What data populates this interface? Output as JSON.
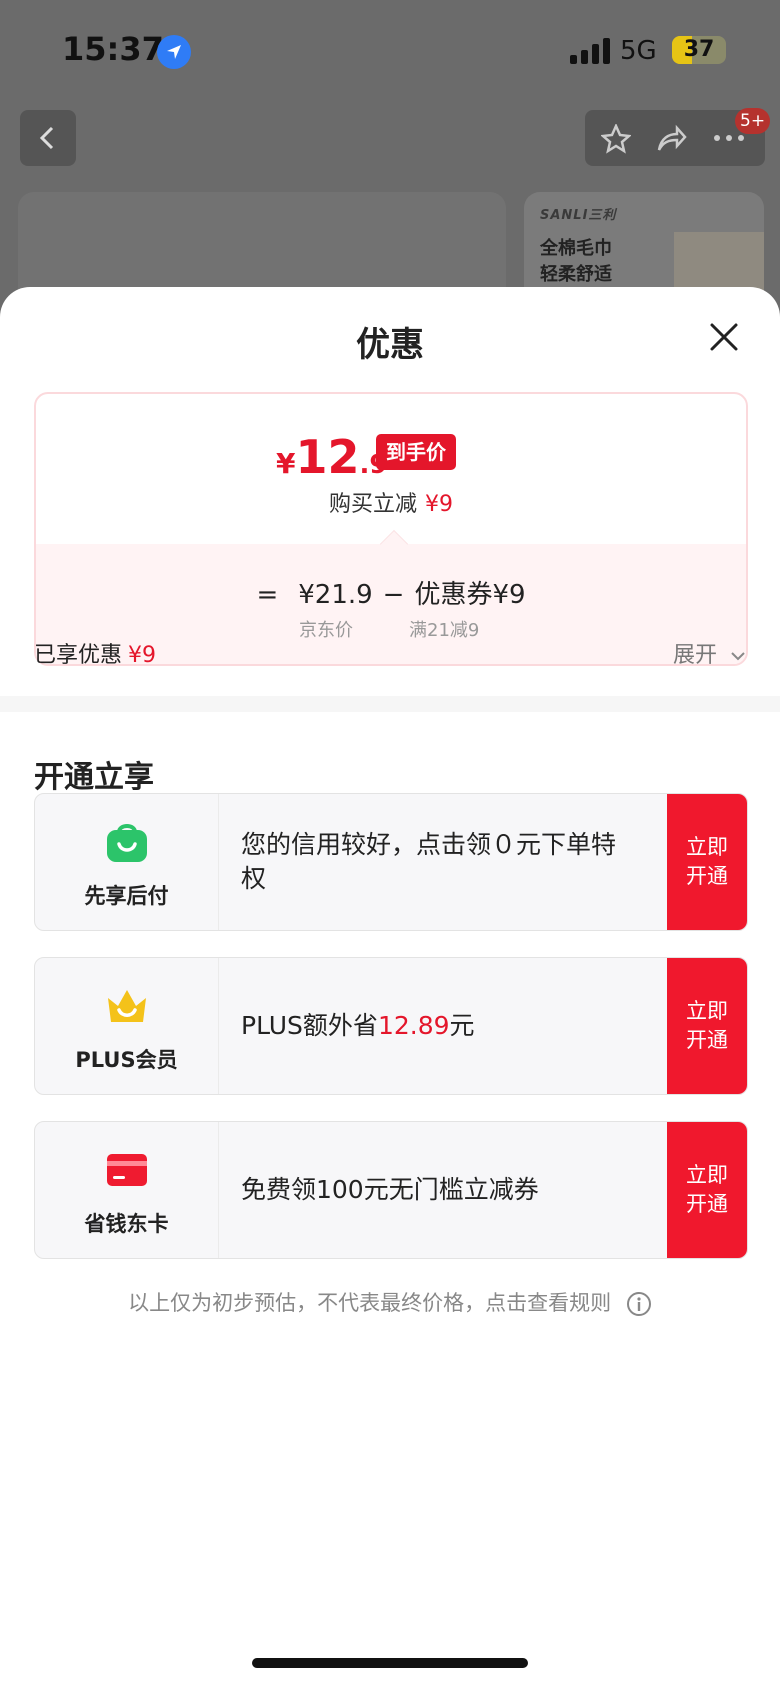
{
  "status_bar": {
    "time": "15:37",
    "network": "5G",
    "battery": "37"
  },
  "header": {
    "badge": "5+"
  },
  "background_card": {
    "brand": "SANLI三利",
    "line1": "全棉毛巾",
    "line2": "轻柔舒适"
  },
  "sheet": {
    "title": "优惠"
  },
  "price": {
    "currency": "¥",
    "integer": "12",
    "decimal": ".9",
    "tag": "到手价",
    "reduce_label": "购买立减",
    "reduce_amount": "¥9",
    "formula_eq": "=",
    "jd_price": "¥21.9",
    "minus": "−",
    "coupon": "优惠券¥9",
    "jd_price_label": "京东价",
    "coupon_rule": "满21减9"
  },
  "enjoyed": {
    "label": "已享优惠",
    "amount": "¥9",
    "expand": "展开"
  },
  "section": {
    "title": "开通立享"
  },
  "offers": [
    {
      "name": "先享后付",
      "icon": "shopping-bag-icon",
      "text_before": "您的信用较好，点击领０元下单特权",
      "text_highlight": "",
      "text_after": "",
      "button": "立即开通"
    },
    {
      "name": "PLUS会员",
      "icon": "crown-icon",
      "text_before": "PLUS额外省",
      "text_highlight": "12.89",
      "text_after": "元",
      "button": "立即开通"
    },
    {
      "name": "省钱东卡",
      "icon": "card-icon",
      "text_before": "免费领100元无门槛立减券",
      "text_highlight": "",
      "text_after": "",
      "button": "立即开通"
    }
  ],
  "footnote": "以上仅为初步预估，不代表最终价格，点击查看规则",
  "colors": {
    "accent": "#e4162b",
    "green": "#2cc46a",
    "gold": "#f4c21a"
  }
}
